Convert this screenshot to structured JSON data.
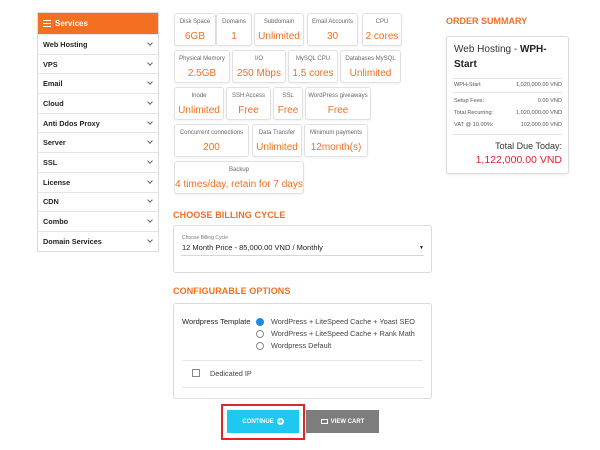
{
  "sidebar": {
    "header": "Services",
    "items": [
      {
        "label": "Web Hosting"
      },
      {
        "label": "VPS"
      },
      {
        "label": "Email"
      },
      {
        "label": "Cloud"
      },
      {
        "label": "Anti Ddos Proxy"
      },
      {
        "label": "Server"
      },
      {
        "label": "SSL"
      },
      {
        "label": "License"
      },
      {
        "label": "CDN"
      },
      {
        "label": "Combo"
      },
      {
        "label": "Domain Services"
      }
    ]
  },
  "specs": [
    {
      "label": "Disk Space",
      "value": "6GB"
    },
    {
      "label": "Domains",
      "value": "1"
    },
    {
      "label": "Subdomain",
      "value": "Unlimited"
    },
    {
      "label": "Email Accounts",
      "value": "30"
    },
    {
      "label": "CPU",
      "value": "2 cores"
    },
    {
      "label": "Physical Memory",
      "value": "2.5GB"
    },
    {
      "label": "I/O",
      "value": "250 Mbps"
    },
    {
      "label": "MySQL CPU",
      "value": "1.5 cores"
    },
    {
      "label": "Databases MySQL",
      "value": "Unlimited"
    },
    {
      "label": "Inode",
      "value": "Unlimited"
    },
    {
      "label": "SSH Access",
      "value": "Free"
    },
    {
      "label": "SSL",
      "value": "Free"
    },
    {
      "label": "WordPress giveaways",
      "value": "Free"
    },
    {
      "label": "Concurrent connections",
      "value": "200"
    },
    {
      "label": "Data Transfer",
      "value": "Unlimited"
    },
    {
      "label": "Minimum payments",
      "value": "12month(s)"
    },
    {
      "label": "Backup",
      "value": "4 times/day, retain for 7 days"
    }
  ],
  "billing": {
    "title": "CHOOSE BILLING CYCLE",
    "field_label": "Choose Billing Cycle",
    "selected": "12 Month Price - 85,000.00 VND / Monthly",
    "caret": "▼"
  },
  "config": {
    "title": "CONFIGURABLE OPTIONS",
    "template_label": "Wordpress Template",
    "options": [
      {
        "label": "WordPress + LiteSpeed Cache + Yoast SEO",
        "selected": true
      },
      {
        "label": "WordPress + LiteSpeed Cache + Rank Math",
        "selected": false
      },
      {
        "label": "Wordpress Default",
        "selected": false
      }
    ],
    "addon_label": "Dedicated IP"
  },
  "buttons": {
    "continue": "CONTINUE",
    "continue_arrow": "➔",
    "view_cart": "VIEW CART"
  },
  "order_summary": {
    "title": "ORDER SUMMARY",
    "product_prefix": "Web Hosting - ",
    "product_name": "WPH-Start",
    "line_item_label": "WPH-Start",
    "line_item_value": "1,020,000.00 VND",
    "setup_fees_label": "Setup Fees:",
    "setup_fees_value": "0.00 VND",
    "recurring_label": "Total Recurring:",
    "recurring_value": "1,020,000.00 VND",
    "vat_label": "VAT @ 10.00%:",
    "vat_value": "102,000.00 VND",
    "total_label": "Total Due Today:",
    "total_value": "1,122,000.00 VND"
  },
  "colors": {
    "accent": "#f36f21",
    "continue_button": "#1ec8f0",
    "view_cart_button": "#7d7d7d",
    "highlight_frame": "#e0262c",
    "total_due": "#e0262c"
  }
}
